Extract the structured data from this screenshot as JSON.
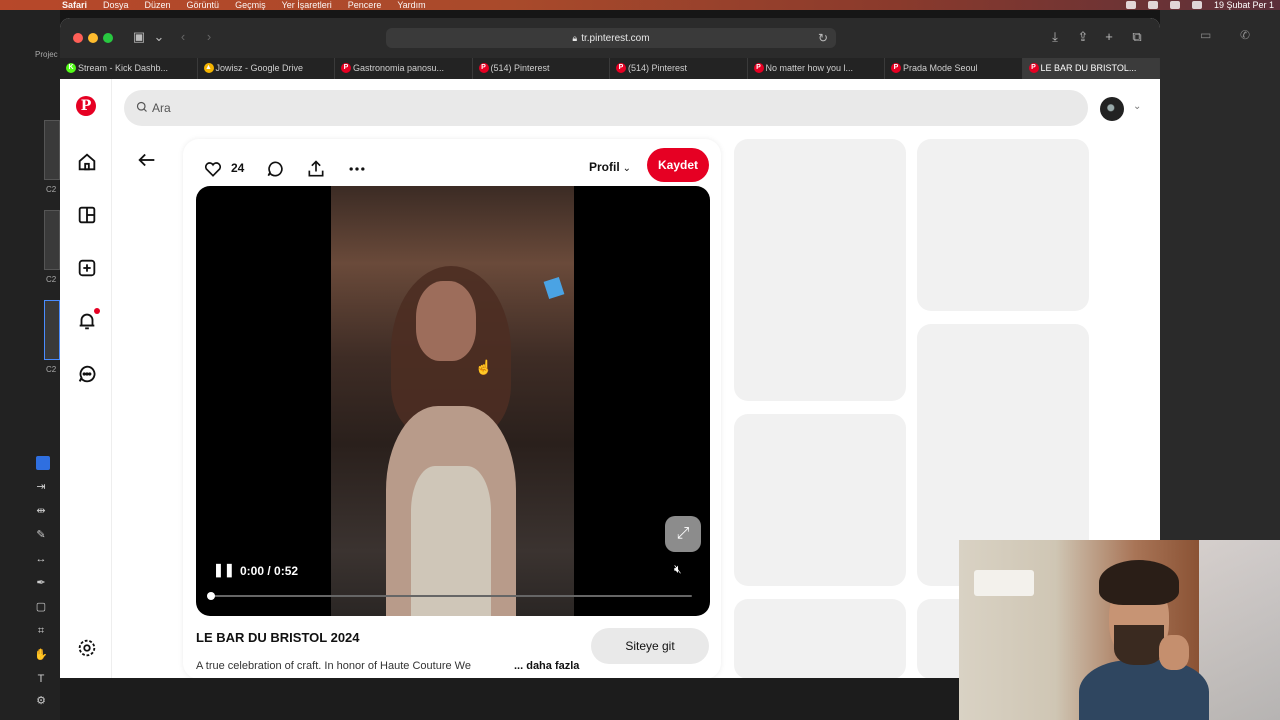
{
  "menubar": {
    "app": "Safari",
    "items": [
      "Dosya",
      "Düzen",
      "Görüntü",
      "Geçmiş",
      "Yer İşaretleri",
      "Pencere",
      "Yardım"
    ],
    "clock": "19 Şubat Per 1"
  },
  "bg_app": {
    "project_label": "Projec",
    "clip_labels": [
      "C2",
      "C2",
      "C2"
    ]
  },
  "browser": {
    "url": "tr.pinterest.com",
    "tabs": [
      {
        "label": "Stream - Kick Dashb...",
        "favicon": "K",
        "favicon_color": "#53fc18"
      },
      {
        "label": "Jowisz - Google Drive",
        "favicon": "▲",
        "favicon_color": "#f4b400"
      },
      {
        "label": "Gastronomia panosu...",
        "favicon": "P",
        "favicon_color": "#e60023"
      },
      {
        "label": "(514) Pinterest",
        "favicon": "P",
        "favicon_color": "#e60023"
      },
      {
        "label": "(514) Pinterest",
        "favicon": "P",
        "favicon_color": "#e60023"
      },
      {
        "label": "No matter how you l...",
        "favicon": "P",
        "favicon_color": "#e60023"
      },
      {
        "label": "Prada Mode Seoul",
        "favicon": "P",
        "favicon_color": "#e60023"
      },
      {
        "label": "LE BAR DU BRISTOL...",
        "favicon": "P",
        "favicon_color": "#e60023",
        "active": true
      }
    ]
  },
  "pinterest": {
    "logo_letter": "P",
    "brand_color": "#e60023",
    "search_placeholder": "Ara",
    "nav_icons": [
      "home-icon",
      "explore-icon",
      "create-icon",
      "notifications-icon",
      "messages-icon",
      "settings-icon"
    ]
  },
  "pin": {
    "likes": "24",
    "profile_label": "Profil",
    "save_label": "Kaydet",
    "video": {
      "time": "0:00 / 0:52",
      "progress": 0.0
    },
    "title": "LE BAR DU BRISTOL 2024",
    "description": "A true celebration of craft. In honor of Haute Couture We",
    "more_label": "... daha fazla",
    "visit_label": "Siteye git"
  }
}
